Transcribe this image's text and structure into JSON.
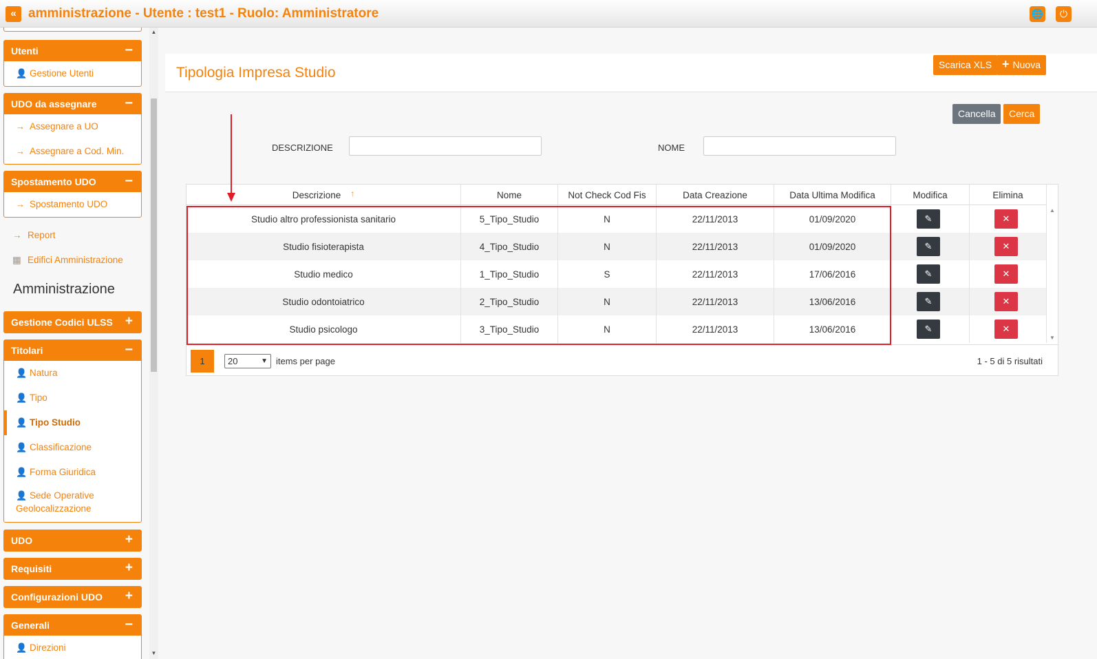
{
  "topbar": {
    "collapse_glyph": "«",
    "title": "amministrazione - Utente : test1 - Ruolo: Amministratore",
    "globe_glyph": "🌐",
    "power_glyph": "⏻"
  },
  "sidebar": {
    "utenti": {
      "header": "Utenti",
      "toggle": "−",
      "items": [
        {
          "label": "Gestione Utenti",
          "icon": "user-edit-icon"
        }
      ]
    },
    "udo_assegnare": {
      "header": "UDO da assegnare",
      "toggle": "−",
      "items": [
        {
          "label": "Assegnare a UO",
          "icon": "arrow-right-icon"
        },
        {
          "label": "Assegnare a Cod. Min.",
          "icon": "arrow-right-icon"
        }
      ]
    },
    "spostamento": {
      "header": "Spostamento UDO",
      "toggle": "−",
      "items": [
        {
          "label": "Spostamento UDO",
          "icon": "arrow-right-icon"
        }
      ]
    },
    "links": [
      {
        "label": "Report",
        "icon": "arrow-right-icon"
      },
      {
        "label": "Edifici Amministrazione",
        "icon": "building-icon"
      }
    ],
    "section_title": "Amministrazione",
    "gestione_codici": {
      "header": "Gestione Codici ULSS",
      "toggle": "+"
    },
    "titolari": {
      "header": "Titolari",
      "toggle": "−",
      "items": [
        {
          "label": "Natura"
        },
        {
          "label": "Tipo"
        },
        {
          "label": "Tipo Studio"
        },
        {
          "label": "Classificazione"
        },
        {
          "label": "Forma Giuridica"
        },
        {
          "label": "Sede Operative Geolocalizzazione"
        }
      ]
    },
    "udo": {
      "header": "UDO",
      "toggle": "+"
    },
    "requisiti": {
      "header": "Requisiti",
      "toggle": "+"
    },
    "configurazioni": {
      "header": "Configurazioni UDO",
      "toggle": "+"
    },
    "generali": {
      "header": "Generali",
      "toggle": "−",
      "items": [
        {
          "label": "Direzioni"
        }
      ]
    }
  },
  "main": {
    "page_title": "Tipologia Impresa Studio",
    "btn_scarica": "Scarica XLS",
    "btn_nuova": "Nuova",
    "btn_nuova_glyph": "+",
    "btn_cancella": "Cancella",
    "btn_cerca": "Cerca",
    "filter_descrizione_label": "DESCRIZIONE",
    "filter_descrizione_value": "",
    "filter_nome_label": "NOME",
    "filter_nome_value": ""
  },
  "grid": {
    "columns": [
      "Descrizione",
      "Nome",
      "Not Check Cod Fis",
      "Data Creazione",
      "Data Ultima Modifica",
      "Modifica",
      "Elimina"
    ],
    "sort_glyph": "↑",
    "edit_glyph": "✎",
    "delete_glyph": "✕",
    "rows": [
      {
        "descrizione": "Studio altro professionista sanitario",
        "nome": "5_Tipo_Studio",
        "check": "N",
        "creazione": "22/11/2013",
        "modifica": "01/09/2020"
      },
      {
        "descrizione": "Studio fisioterapista",
        "nome": "4_Tipo_Studio",
        "check": "N",
        "creazione": "22/11/2013",
        "modifica": "01/09/2020"
      },
      {
        "descrizione": "Studio medico",
        "nome": "1_Tipo_Studio",
        "check": "S",
        "creazione": "22/11/2013",
        "modifica": "17/06/2016"
      },
      {
        "descrizione": "Studio odontoiatrico",
        "nome": "2_Tipo_Studio",
        "check": "N",
        "creazione": "22/11/2013",
        "modifica": "13/06/2016"
      },
      {
        "descrizione": "Studio psicologo",
        "nome": "3_Tipo_Studio",
        "check": "N",
        "creazione": "22/11/2013",
        "modifica": "13/06/2016"
      }
    ],
    "pager": {
      "current_page": "1",
      "page_size": "20",
      "items_per_page_label": "items per page",
      "results_label": "1 - 5 di 5 risultati"
    }
  },
  "colors": {
    "accent": "#f5820b",
    "annotation": "#e11d2a",
    "danger": "#dc3545",
    "dark": "#343a40"
  }
}
